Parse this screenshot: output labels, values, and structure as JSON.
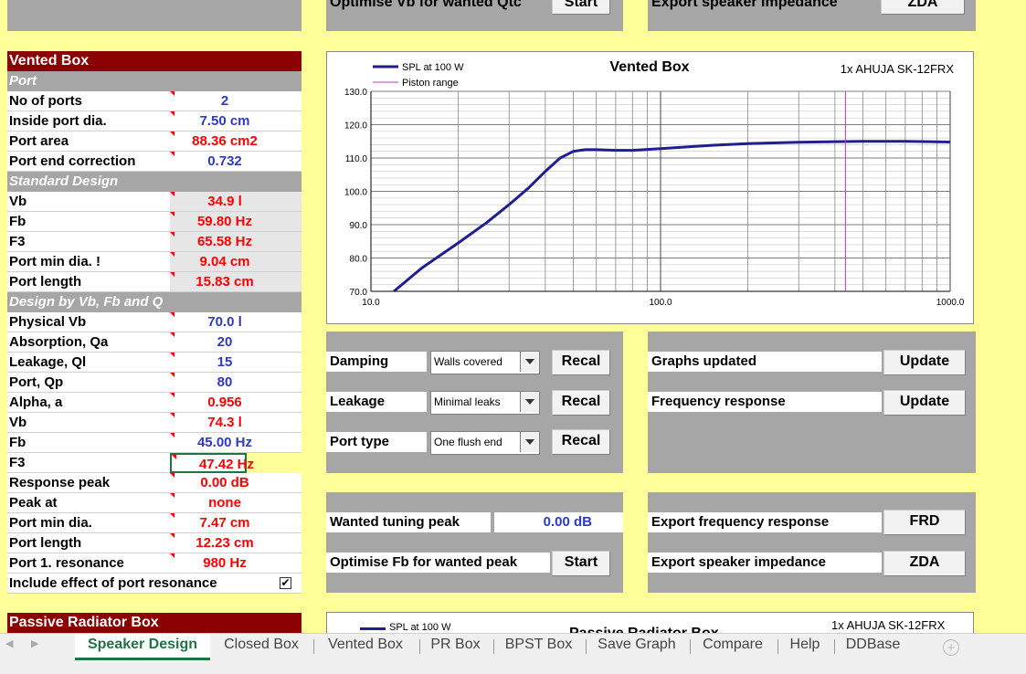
{
  "top_strip": {
    "left_btn_label": "Optimise Vb for wanted Qtc",
    "start_label": "Start",
    "right_label": "Export speaker impedance",
    "zda_label": "ZDA"
  },
  "vented": {
    "header": "Vented Box",
    "port_header": "Port",
    "rows_port": [
      {
        "label": "No of ports",
        "value": "2",
        "color": "blue"
      },
      {
        "label": "Inside port dia.",
        "value": "7.50 cm",
        "color": "blue"
      },
      {
        "label": "Port area",
        "value": "88.36 cm2",
        "color": "red"
      },
      {
        "label": "Port end correction",
        "value": "0.732",
        "color": "blue"
      }
    ],
    "std_header": "Standard Design",
    "rows_std": [
      {
        "label": "Vb",
        "value": "34.9 l"
      },
      {
        "label": "Fb",
        "value": "59.80 Hz"
      },
      {
        "label": "F3",
        "value": "65.58 Hz"
      },
      {
        "label": "Port min dia. !",
        "value": "9.04 cm"
      },
      {
        "label": "Port length",
        "value": "15.83 cm"
      }
    ],
    "design_header": "Design by Vb, Fb and Q",
    "rows_design": [
      {
        "label": "Physical Vb",
        "value": "70.0 l",
        "color": "blue"
      },
      {
        "label": "Absorption, Qa",
        "value": "20",
        "color": "blue"
      },
      {
        "label": "Leakage, Ql",
        "value": "15",
        "color": "blue"
      },
      {
        "label": "Port, Qp",
        "value": "80",
        "color": "blue"
      },
      {
        "label": "Alpha, a",
        "value": "0.956",
        "color": "red"
      },
      {
        "label": "Vb",
        "value": "74.3 l",
        "color": "red"
      },
      {
        "label": "Fb",
        "value": "45.00 Hz",
        "color": "blue"
      },
      {
        "label": "F3",
        "value": "47.42 Hz",
        "color": "red"
      },
      {
        "label": "Response peak",
        "value": "0.00 dB",
        "color": "red"
      },
      {
        "label": "Peak at",
        "value": "none",
        "color": "red"
      },
      {
        "label": "Port min dia.",
        "value": "7.47 cm",
        "color": "red"
      },
      {
        "label": "Port length",
        "value": "12.23 cm",
        "color": "red"
      },
      {
        "label": "Port 1. resonance",
        "value": "980 Hz",
        "color": "red"
      }
    ],
    "include_label": "Include effect of port resonance",
    "include_checked": true
  },
  "passive": {
    "header": "Passive Radiator Box",
    "legend": "SPL at 100 W",
    "title": "Passive Radiator Box",
    "speaker": "1x AHUJA SK-12FRX"
  },
  "chart_data": {
    "type": "line",
    "title": "Vented Box",
    "subtitle": "1x AHUJA SK-12FRX",
    "legend": [
      "SPL at 100 W",
      "Piston range"
    ],
    "x_scale": "log",
    "xlim": [
      10,
      1000
    ],
    "ylim": [
      70,
      130
    ],
    "x_ticks": [
      "10.0",
      "100.0",
      "1000.0"
    ],
    "y_ticks": [
      "70.0",
      "80.0",
      "90.0",
      "100.0",
      "110.0",
      "120.0",
      "130.0"
    ],
    "series": [
      {
        "name": "SPL at 100 W",
        "color": "#1f1f8f",
        "x": [
          12,
          15,
          20,
          25,
          30,
          35,
          40,
          45,
          50,
          55,
          60,
          70,
          80,
          100,
          150,
          200,
          300,
          400,
          500,
          700,
          1000
        ],
        "y": [
          70,
          77,
          84.5,
          90.5,
          96,
          101,
          106,
          110,
          112,
          112.5,
          112.5,
          112.3,
          112.3,
          112.8,
          113.8,
          114.3,
          114.7,
          114.9,
          115.0,
          115.0,
          114.8
        ]
      },
      {
        "name": "Piston range",
        "color": "#cc33cc",
        "x": [
          435,
          435
        ],
        "y": [
          70,
          130
        ]
      }
    ],
    "grid": true
  },
  "mid_panel": {
    "damping_label": "Damping",
    "damping_value": "Walls covered",
    "leakage_label": "Leakage",
    "leakage_value": "Minimal leaks",
    "porttype_label": "Port type",
    "porttype_value": "One flush end",
    "recal_label": "Recal",
    "wanted_peak_label": "Wanted tuning peak",
    "wanted_peak_value": "0.00 dB",
    "optimise_label": "Optimise Fb for wanted peak",
    "start_label": "Start"
  },
  "right_panel": {
    "graphs_label": "Graphs updated",
    "freq_label": "Frequency response",
    "update_label": "Update",
    "export_frd_label": "Export frequency response",
    "frd_label": "FRD",
    "export_zda_label": "Export speaker impedance",
    "zda_label": "ZDA"
  },
  "tabs": [
    "Speaker Design",
    "Closed Box",
    "Vented Box",
    "PR Box",
    "BPST Box",
    "Save Graph",
    "Compare",
    "Help",
    "DDBase"
  ],
  "active_tab": 0
}
